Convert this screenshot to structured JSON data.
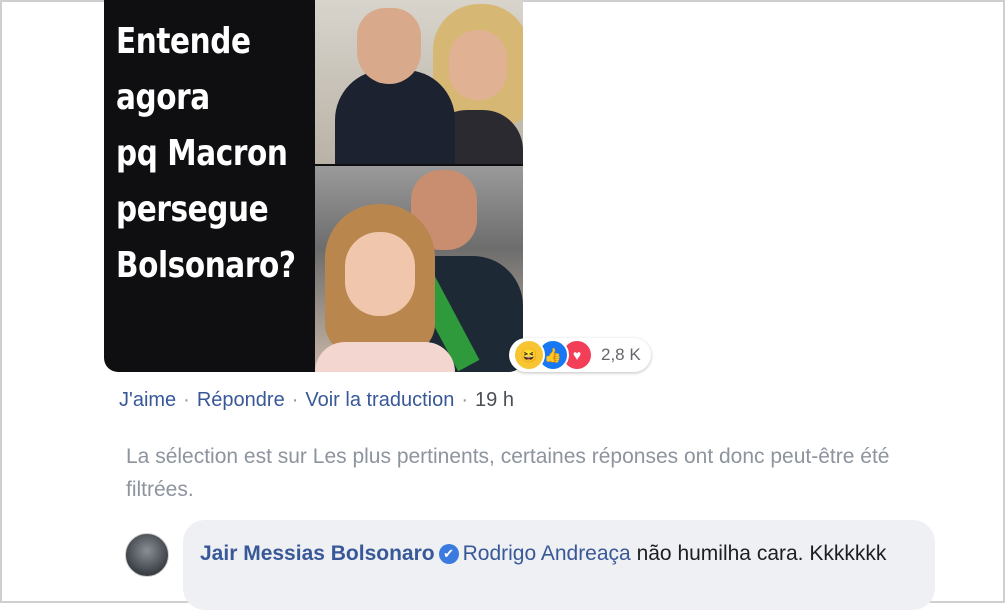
{
  "post": {
    "meme_lines": [
      "Entende",
      "agora",
      "pq Macron",
      "persegue",
      "Bolsonaro?"
    ],
    "reactions": {
      "icons": [
        "haha-icon",
        "like-icon",
        "love-icon"
      ],
      "count": "2,8 K",
      "colors": {
        "haha": "#f7c531",
        "like": "#1877f2",
        "love": "#f33e58"
      }
    }
  },
  "actions": {
    "like": "J'aime",
    "reply": "Répondre",
    "translate": "Voir la traduction",
    "time": "19 h",
    "separator": "·"
  },
  "notice": {
    "text": "La sélection est sur Les plus pertinents, certaines réponses ont donc peut-être été filtrées."
  },
  "comment": {
    "author": "Jair Messias Bolsonaro",
    "verified_icon": "verified-badge-icon",
    "verified_glyph": "✔",
    "mention": "Rodrigo Andreaça",
    "text": " não humilha cara. Kkkkkkk"
  },
  "colors": {
    "link": "#385898",
    "muted": "#8d949e",
    "bubble": "#eef0f3"
  }
}
